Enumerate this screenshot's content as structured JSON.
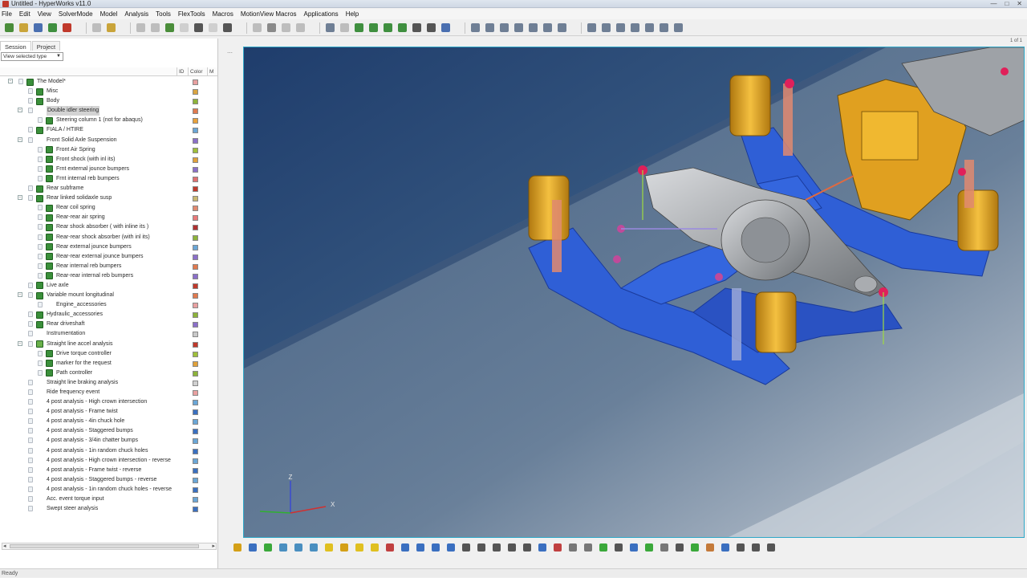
{
  "window": {
    "title": "Untitled - HyperWorks v11.0",
    "controls": [
      "—",
      "□",
      "✕"
    ]
  },
  "menu": [
    "File",
    "Edit",
    "View",
    "SolverMode",
    "Model",
    "Analysis",
    "Tools",
    "FlexTools",
    "Macros",
    "MotionView Macros",
    "Applications",
    "Help"
  ],
  "toolbar": {
    "page_indicator": "1 of 1",
    "groups": [
      [
        {
          "icon": "wand-icon",
          "color": "#4a8d3a"
        },
        {
          "icon": "open-icon",
          "color": "#c9a43a"
        },
        {
          "icon": "save-icon",
          "color": "#4a6fb0"
        },
        {
          "icon": "import-icon",
          "color": "#3f8f3f"
        },
        {
          "icon": "export-icon",
          "color": "#c0392b"
        }
      ],
      [
        {
          "icon": "undo-icon",
          "color": "#bdbdbd"
        },
        {
          "icon": "folder-icon",
          "color": "#c9a43a"
        }
      ],
      [
        {
          "icon": "back-icon",
          "color": "#bdbdbd"
        },
        {
          "icon": "forward-icon",
          "color": "#bdbdbd"
        },
        {
          "icon": "add-page-icon",
          "color": "#4a8d3a"
        },
        {
          "icon": "page-icon",
          "color": "#cfcfcf"
        },
        {
          "icon": "window-icon",
          "color": "#555555"
        },
        {
          "icon": "layout-icon",
          "color": "#cfcfcf"
        },
        {
          "icon": "print-icon",
          "color": "#555555"
        }
      ],
      [
        {
          "icon": "cut-icon",
          "color": "#bdbdbd"
        },
        {
          "icon": "copy-icon",
          "color": "#8a8a8a"
        },
        {
          "icon": "paste-icon",
          "color": "#bdbdbd"
        },
        {
          "icon": "delete-icon",
          "color": "#bdbdbd"
        }
      ],
      [
        {
          "icon": "find-icon",
          "color": "#6f7f95"
        },
        {
          "icon": "dim-icon",
          "color": "#bdbdbd"
        },
        {
          "icon": "fit-icon",
          "color": "#3f8f3f"
        },
        {
          "icon": "fit-x-icon",
          "color": "#3f8f3f"
        },
        {
          "icon": "fit-y-icon",
          "color": "#3f8f3f"
        },
        {
          "icon": "fit-z-icon",
          "color": "#3f8f3f"
        },
        {
          "icon": "axes-icon",
          "color": "#555555"
        },
        {
          "icon": "box-icon",
          "color": "#555555"
        },
        {
          "icon": "shade-icon",
          "color": "#4a6fb0"
        }
      ],
      [
        {
          "icon": "zoom-area-icon",
          "color": "#6f7f95"
        },
        {
          "icon": "zoom-icon",
          "color": "#6f7f95"
        },
        {
          "icon": "pan-icon",
          "color": "#6f7f95"
        },
        {
          "icon": "hand-icon",
          "color": "#6f7f95"
        },
        {
          "icon": "rotate-x-icon",
          "color": "#6f7f95"
        },
        {
          "icon": "rotate-y-icon",
          "color": "#6f7f95"
        },
        {
          "icon": "spin-icon",
          "color": "#6f7f95"
        }
      ],
      [
        {
          "icon": "view-iso-icon",
          "color": "#6f7f95"
        },
        {
          "icon": "view-front-icon",
          "color": "#6f7f95"
        },
        {
          "icon": "view-back-icon",
          "color": "#6f7f95"
        },
        {
          "icon": "view-top-icon",
          "color": "#6f7f95"
        },
        {
          "icon": "view-left-icon",
          "color": "#6f7f95"
        },
        {
          "icon": "view-right-icon",
          "color": "#6f7f95"
        },
        {
          "icon": "view-bottom-icon",
          "color": "#6f7f95"
        }
      ]
    ]
  },
  "panel": {
    "tabs": [
      "Session",
      "Project"
    ],
    "view_selector": "View selected type",
    "columns": [
      "ID",
      "Color",
      "M"
    ],
    "tree": [
      {
        "label": "The Model*",
        "level": 0,
        "exp": "−",
        "icon": "model",
        "color": "#e8a0a0"
      },
      {
        "label": "Misc",
        "level": 1,
        "exp": "",
        "icon": "system",
        "color": "#d9a441"
      },
      {
        "label": "Body",
        "level": 1,
        "exp": "",
        "icon": "system",
        "color": "#8db33a"
      },
      {
        "label": "Double idler steering",
        "level": 1,
        "exp": "−",
        "icon": "",
        "color": "#e07a4f",
        "selected": true
      },
      {
        "label": "Steering column 1 (not for abaqus)",
        "level": 2,
        "exp": "",
        "icon": "system",
        "color": "#e8a13a"
      },
      {
        "label": "FIALA / HTIRE",
        "level": 1,
        "exp": "",
        "icon": "system",
        "color": "#6aa6d6"
      },
      {
        "label": "Front Solid Axle Suspension",
        "level": 1,
        "exp": "−",
        "icon": "",
        "color": "#8b6fc9"
      },
      {
        "label": "Front Air Spring",
        "level": 2,
        "exp": "",
        "icon": "system",
        "color": "#9fbf3a"
      },
      {
        "label": "Front shock (with inl its)",
        "level": 2,
        "exp": "",
        "icon": "system",
        "color": "#e0a13a"
      },
      {
        "label": "Frnt external jounce bumpers",
        "level": 2,
        "exp": "",
        "icon": "system",
        "color": "#8b6fc9"
      },
      {
        "label": "Frnt internal reb bumpers",
        "level": 2,
        "exp": "",
        "icon": "system",
        "color": "#e07070"
      },
      {
        "label": "Rear subframe",
        "level": 1,
        "exp": "",
        "icon": "system",
        "color": "#c0392b"
      },
      {
        "label": "Rear linked solidaxle susp",
        "level": 1,
        "exp": "−",
        "icon": "system",
        "color": "#c9b870"
      },
      {
        "label": "Rear coil spring",
        "level": 2,
        "exp": "",
        "icon": "system",
        "color": "#e08a70"
      },
      {
        "label": "Rear-rear air spring",
        "level": 2,
        "exp": "",
        "icon": "system",
        "color": "#e87a7a"
      },
      {
        "label": "Rear shock absorber ( with inline its )",
        "level": 2,
        "exp": "",
        "icon": "system",
        "color": "#b03030"
      },
      {
        "label": "Rear-rear shock absorber (with inl its)",
        "level": 2,
        "exp": "",
        "icon": "system",
        "color": "#8db33a"
      },
      {
        "label": "Rear external jounce bumpers",
        "level": 2,
        "exp": "",
        "icon": "system",
        "color": "#6aa6d6"
      },
      {
        "label": "Rear-rear external jounce bumpers",
        "level": 2,
        "exp": "",
        "icon": "system",
        "color": "#8b6fc9"
      },
      {
        "label": "Rear internal reb bumpers",
        "level": 2,
        "exp": "",
        "icon": "system",
        "color": "#e07a4f"
      },
      {
        "label": "Rear-rear internal reb bumpers",
        "level": 2,
        "exp": "",
        "icon": "system",
        "color": "#8b6fc9"
      },
      {
        "label": "Live axle",
        "level": 1,
        "exp": "",
        "icon": "system",
        "color": "#c0392b"
      },
      {
        "label": "Variable mount longitudinal",
        "level": 1,
        "exp": "−",
        "icon": "system",
        "color": "#e07a4f"
      },
      {
        "label": "Engine_accessories",
        "level": 2,
        "exp": "",
        "icon": "",
        "color": "#e8a0a0"
      },
      {
        "label": "Hydraulic_accessories",
        "level": 1,
        "exp": "",
        "icon": "system",
        "color": "#8db33a"
      },
      {
        "label": "Rear driveshaft",
        "level": 1,
        "exp": "",
        "icon": "system",
        "color": "#8b6fc9"
      },
      {
        "label": "Instrumentation",
        "level": 1,
        "exp": "",
        "icon": "",
        "color": "#c8c8c8"
      },
      {
        "label": "Straight line accel analysis",
        "level": 1,
        "exp": "−",
        "icon": "analysis",
        "color": "#c0392b"
      },
      {
        "label": "Drive torque controller",
        "level": 2,
        "exp": "",
        "icon": "system",
        "color": "#9fbf3a"
      },
      {
        "label": "marker for the request",
        "level": 2,
        "exp": "",
        "icon": "system",
        "color": "#e0a13a"
      },
      {
        "label": "Path controller",
        "level": 2,
        "exp": "",
        "icon": "system",
        "color": "#8db33a"
      },
      {
        "label": "Straight line braking analysis",
        "level": 1,
        "exp": "",
        "icon": "",
        "color": "#d0d0d0"
      },
      {
        "label": "Ride frequency event",
        "level": 1,
        "exp": "",
        "icon": "",
        "color": "#e8a0a0"
      },
      {
        "label": "4 post analysis - High crown intersection",
        "level": 1,
        "exp": "",
        "icon": "",
        "color": "#6aa6d6"
      },
      {
        "label": "4 post analysis - Frame twist",
        "level": 1,
        "exp": "",
        "icon": "",
        "color": "#3a6fc0"
      },
      {
        "label": "4 post analysis - 4in chuck hole",
        "level": 1,
        "exp": "",
        "icon": "",
        "color": "#6aa6d6"
      },
      {
        "label": "4 post analysis - Staggered bumps",
        "level": 1,
        "exp": "",
        "icon": "",
        "color": "#3a6fc0"
      },
      {
        "label": "4 post analysis - 3/4in chatter bumps",
        "level": 1,
        "exp": "",
        "icon": "",
        "color": "#6aa6d6"
      },
      {
        "label": "4 post analysis - 1in random chuck holes",
        "level": 1,
        "exp": "",
        "icon": "",
        "color": "#3a6fc0"
      },
      {
        "label": "4 post analysis - High crown intersection - reverse",
        "level": 1,
        "exp": "",
        "icon": "",
        "color": "#6aa6d6"
      },
      {
        "label": "4 post analysis - Frame twist - reverse",
        "level": 1,
        "exp": "",
        "icon": "",
        "color": "#3a6fc0"
      },
      {
        "label": "4 post analysis - Staggered bumps - reverse",
        "level": 1,
        "exp": "",
        "icon": "",
        "color": "#6aa6d6"
      },
      {
        "label": "4 post analysis - 1in random chuck holes - reverse",
        "level": 1,
        "exp": "",
        "icon": "",
        "color": "#3a6fc0"
      },
      {
        "label": "Acc. event torque input",
        "level": 1,
        "exp": "",
        "icon": "",
        "color": "#6aa6d6"
      },
      {
        "label": "Swept steer analysis",
        "level": 1,
        "exp": "",
        "icon": "",
        "color": "#3a6fc0"
      }
    ]
  },
  "viewport": {
    "axis_labels": {
      "z": "Z",
      "x": "X"
    },
    "colors": {
      "ground_dark": "#1e3a66",
      "ground_light": "#a9b6c6",
      "frame": "#2f5fd6",
      "spring": "#e0a020",
      "housing": "#9a9da3",
      "engine": "#e0a020"
    }
  },
  "bottom_toolbar": [
    {
      "icon": "entity-select-icon",
      "color": "#d4a017"
    },
    {
      "icon": "color-wheel-icon",
      "color": "#3a6fc0"
    },
    {
      "icon": "globe-icon",
      "color": "#3aa83a"
    },
    {
      "icon": "image-icon",
      "color": "#4a8fc0"
    },
    {
      "icon": "picture-icon",
      "color": "#4a8fc0"
    },
    {
      "icon": "camera-icon",
      "color": "#4a8fc0"
    },
    {
      "icon": "point-icon",
      "color": "#e0c020"
    },
    {
      "icon": "body-icon",
      "color": "#d4a017"
    },
    {
      "icon": "graphic-icon",
      "color": "#e0c020"
    },
    {
      "icon": "marker-icon",
      "color": "#e0c020"
    },
    {
      "icon": "joint-icon",
      "color": "#c04040"
    },
    {
      "icon": "bushing-icon",
      "color": "#3a6fc0"
    },
    {
      "icon": "beam-icon",
      "color": "#3a6fc0"
    },
    {
      "icon": "field-icon",
      "color": "#3a6fc0"
    },
    {
      "icon": "motion-icon",
      "color": "#3a6fc0"
    },
    {
      "icon": "spring-icon",
      "color": "#555555"
    },
    {
      "icon": "damper-icon",
      "color": "#555555"
    },
    {
      "icon": "force-icon",
      "color": "#555555"
    },
    {
      "icon": "contact-icon",
      "color": "#555555"
    },
    {
      "icon": "gear-icon",
      "color": "#555555"
    },
    {
      "icon": "sensor-icon",
      "color": "#3a6fc0"
    },
    {
      "icon": "polybeam-icon",
      "color": "#c04040"
    },
    {
      "icon": "deform-icon",
      "color": "#777777"
    },
    {
      "icon": "solver-var-icon",
      "color": "#777777"
    },
    {
      "icon": "array-icon",
      "color": "#3aa83a"
    },
    {
      "icon": "diff-eq-icon",
      "color": "#555555"
    },
    {
      "icon": "string-icon",
      "color": "#3a6fc0"
    },
    {
      "icon": "output-icon",
      "color": "#3aa83a"
    },
    {
      "icon": "expression-icon",
      "color": "#777777"
    },
    {
      "icon": "label-text-icon",
      "color": "#555555"
    },
    {
      "icon": "run-icon",
      "color": "#3aa83a"
    },
    {
      "icon": "template-icon",
      "color": "#c47a3a"
    },
    {
      "icon": "data-icon",
      "color": "#3a6fc0"
    },
    {
      "icon": "form-icon",
      "color": "#555555"
    },
    {
      "icon": "braces-icon",
      "color": "#555555"
    },
    {
      "icon": "table-icon",
      "color": "#555555"
    }
  ],
  "status": "Ready"
}
